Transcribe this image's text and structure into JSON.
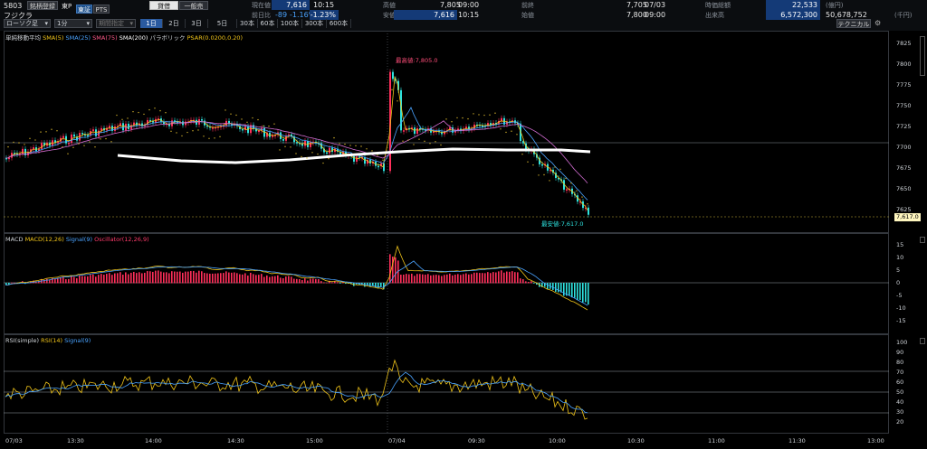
{
  "header": {
    "code": "5803",
    "name": "フジクラ",
    "register_label": "銘柄登録",
    "market_label": "東P",
    "exchange_tabs": [
      {
        "label": "東証",
        "active": true
      },
      {
        "label": "PTS",
        "active": false
      }
    ],
    "account_tabs": [
      {
        "label": "貸借",
        "active": true
      },
      {
        "label": "一般売",
        "active": false
      }
    ],
    "quote": {
      "current_label": "現在値",
      "current_value": "7,616",
      "current_time": "10:15",
      "change_label": "前日比",
      "change_value": "-89",
      "change_pct": "-1.16%",
      "change_pct2": "-1.23%",
      "high_label": "高値",
      "high_value": "7,805",
      "high_time": "09:00",
      "low_label": "安値",
      "low_value": "7,616",
      "low_time": "10:15",
      "prev_label": "前終",
      "prev_value": "7,705",
      "prev_date": "07/03",
      "open_label": "始値",
      "open_value": "7,800",
      "open_time": "09:00",
      "mcap_label": "時価総額",
      "mcap_value": "22,533",
      "mcap_unit": "(億円)",
      "volume_label": "出来高",
      "volume_value": "6,572,300",
      "turnover_value": "50,678,752",
      "turnover_unit": "(千円)"
    }
  },
  "toolbar": {
    "chart_type": "ローソク足",
    "interval": "1分",
    "period_placeholder": "期間指定",
    "ranges": [
      "1日",
      "2日",
      "3日",
      "5日",
      "30本",
      "60本",
      "100本",
      "300本",
      "600本"
    ],
    "selected_range": "1日",
    "technical_button": "テクニカル"
  },
  "colors": {
    "up": "#ff2f5a",
    "down": "#2ee3e0",
    "sma5": "#f0c419",
    "sma25": "#4aa3ff",
    "sma75": "#d06bd0",
    "sma200": "#ffffff",
    "psar": "#cfae2b"
  },
  "price_panel": {
    "legend": [
      {
        "label": "単純移動平均",
        "color": "#cfd3d8"
      },
      {
        "label": "SMA(5)",
        "color": "#f0c419"
      },
      {
        "label": "SMA(25)",
        "color": "#4aa3ff"
      },
      {
        "label": "SMA(75)",
        "color": "#ff5a8a"
      },
      {
        "label": "SMA(200)",
        "color": "#ffffff"
      },
      {
        "label": "パラボリック",
        "color": "#cfd3d8"
      },
      {
        "label": "PSAR(0.0200,0.20)",
        "color": "#f0c419"
      }
    ],
    "y_ticks": [
      "7825",
      "7800",
      "7775",
      "7750",
      "7725",
      "7700",
      "7675",
      "7650",
      "7625"
    ],
    "current_price_tag": "7,617.0",
    "high_annotation": "最高値:7,805.0",
    "low_annotation": "最安値:7,617.0"
  },
  "macd_panel": {
    "legend": [
      {
        "label": "MACD",
        "color": "#cfd3d8"
      },
      {
        "label": "MACD(12,26)",
        "color": "#f0c419"
      },
      {
        "label": "Signal(9)",
        "color": "#4aa3ff"
      },
      {
        "label": "Oscillator(12,26,9)",
        "color": "#ff3b6b"
      }
    ],
    "y_ticks": [
      "15",
      "10",
      "5",
      "0",
      "-5",
      "-10",
      "-15"
    ]
  },
  "rsi_panel": {
    "legend": [
      {
        "label": "RSI(simple)",
        "color": "#cfd3d8"
      },
      {
        "label": "RSI(14)",
        "color": "#f0c419"
      },
      {
        "label": "Signal(9)",
        "color": "#4aa3ff"
      }
    ],
    "y_ticks": [
      "100",
      "90",
      "80",
      "70",
      "60",
      "50",
      "40",
      "30",
      "20"
    ]
  },
  "x_axis": {
    "labels": [
      "07/03",
      "13:30",
      "14:00",
      "14:30",
      "15:00",
      "07/04",
      "09:30",
      "10:00",
      "10:30",
      "11:00",
      "11:30",
      "13:00"
    ]
  }
}
